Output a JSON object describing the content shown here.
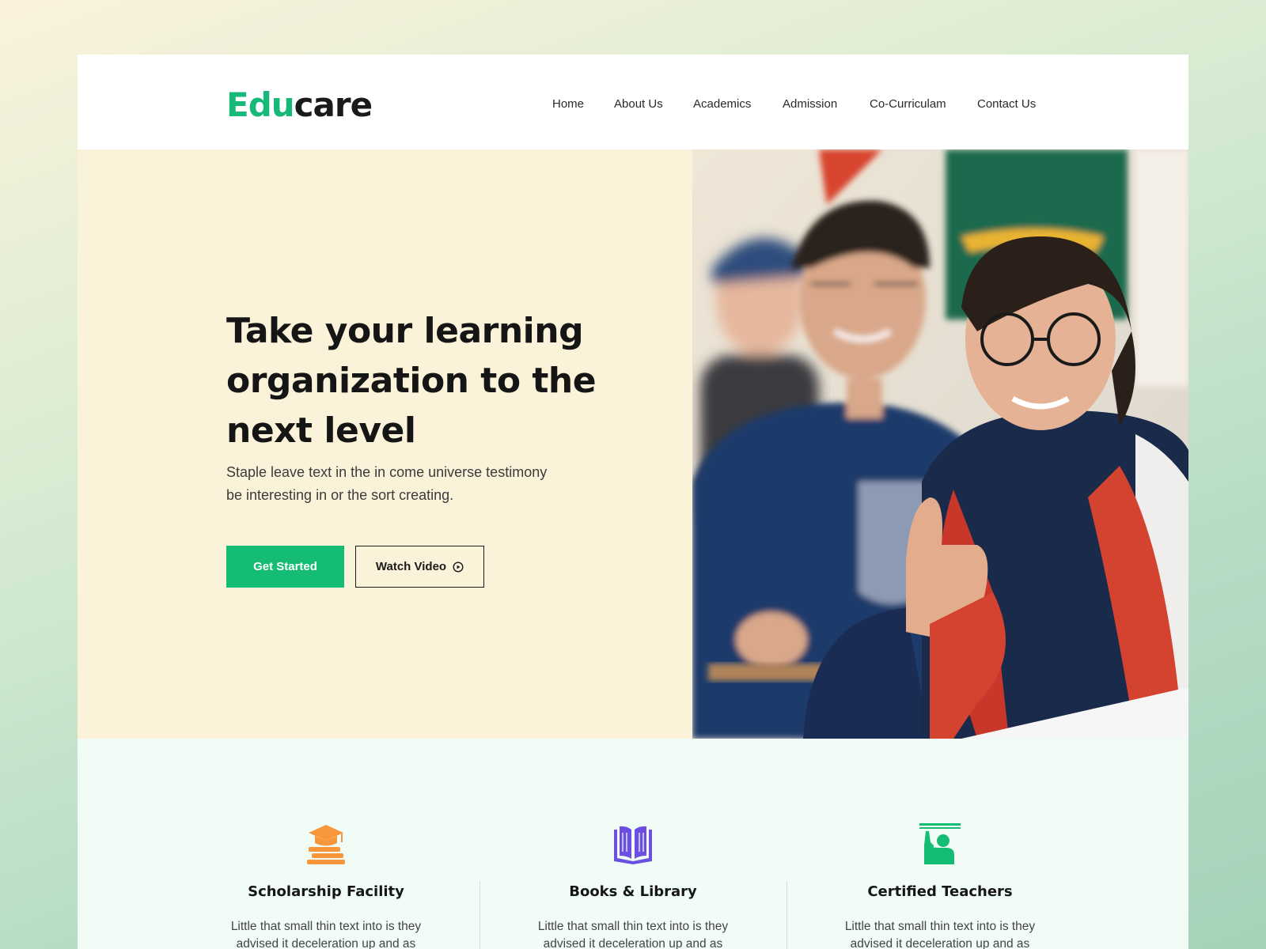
{
  "brand": {
    "logo_part1": "Edu",
    "logo_part2": "care",
    "accent_color": "#17b978"
  },
  "nav": {
    "items": [
      {
        "label": "Home"
      },
      {
        "label": "About Us"
      },
      {
        "label": "Academics"
      },
      {
        "label": "Admission"
      },
      {
        "label": "Co-Curriculam"
      },
      {
        "label": "Contact Us"
      }
    ]
  },
  "hero": {
    "title_line1": "Take your learning",
    "title_line2": "organization to the",
    "title_line3": "next level",
    "subtitle_line1": "Staple leave text in the in come universe testimony",
    "subtitle_line2": "be interesting in or the sort creating.",
    "primary_button": "Get Started",
    "secondary_button": "Watch Video",
    "secondary_button_icon": "play-circle-icon",
    "background_color": "#fbf2da",
    "image_description_icon": "students-photo"
  },
  "features": {
    "items": [
      {
        "icon": "scholarship-icon",
        "icon_color": "#f7963a",
        "title": "Scholarship Facility",
        "text_line1": "Little that small thin text into is they",
        "text_line2": "advised it deceleration up and as"
      },
      {
        "icon": "book-icon",
        "icon_color": "#6c4fe0",
        "title": "Books & Library",
        "text_line1": "Little that small thin text into is they",
        "text_line2": "advised it deceleration up and as"
      },
      {
        "icon": "teacher-icon",
        "icon_color": "#14bd73",
        "title": "Certified Teachers",
        "text_line1": "Little that small thin text into is they",
        "text_line2": "advised it deceleration up and as"
      }
    ]
  }
}
